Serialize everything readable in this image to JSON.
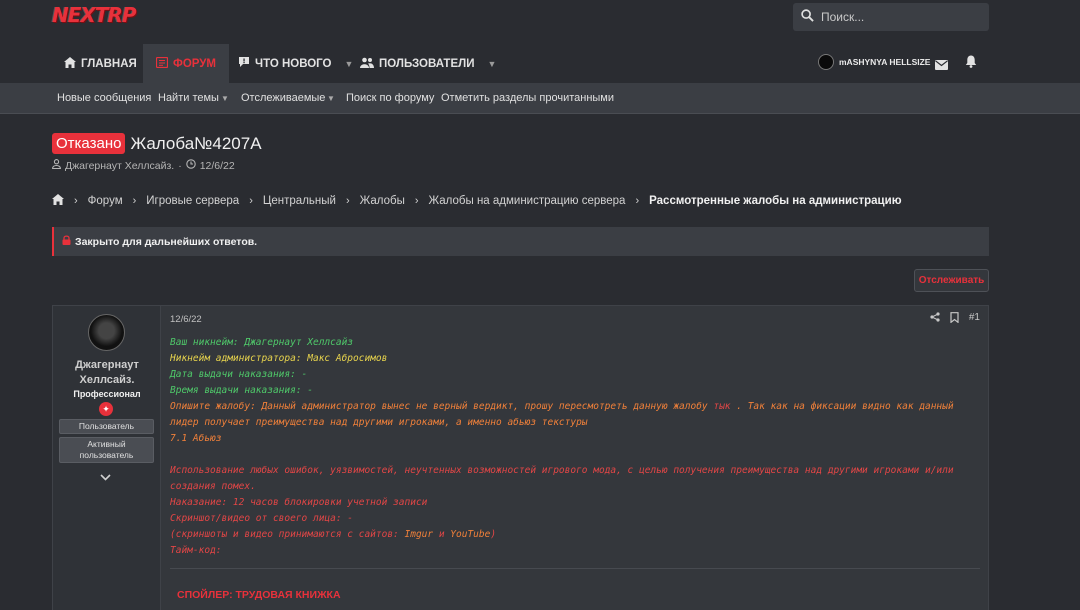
{
  "header": {
    "logo_text": "NEXTRP",
    "search_placeholder": "Поиск..."
  },
  "nav": {
    "items": [
      {
        "label": "ГЛАВНАЯ",
        "icon": "home-icon"
      },
      {
        "label": "ФОРУМ",
        "icon": "forum-icon",
        "active": true
      },
      {
        "label": "ЧТО НОВОГО",
        "icon": "whats-new-icon"
      },
      {
        "label": "ПОЛЬЗОВАТЕЛИ",
        "icon": "users-icon"
      }
    ],
    "username": "mASHYNYA HELLSIZE"
  },
  "subnav": [
    "Новые сообщения",
    "Найти темы",
    "Отслеживаемые",
    "Поиск по форуму",
    "Отметить разделы прочитанными"
  ],
  "thread": {
    "prefix": "Отказано",
    "title": "Жалоба№4207A",
    "author": "Джагернаут Хеллсайз.",
    "date": "12/6/22"
  },
  "breadcrumbs": [
    "Форум",
    "Игровые сервера",
    "Центральный",
    "Жалобы",
    "Жалобы на администрацию сервера",
    "Рассмотренные жалобы на администрацию"
  ],
  "notice": "Закрыто для дальнейших ответов.",
  "watch_button": "Отслеживать",
  "post": {
    "user_name": "Джагернаут Хеллсайз.",
    "user_role": "Профессионал",
    "banner_1": "Пользователь",
    "banner_2": "Активный пользователь",
    "date": "12/6/22",
    "number": "#1",
    "lines": {
      "l1": "Ваш никнейм: Джагернаут Хеллсайз",
      "l2": "Никнейм администратора: Макс Абросимов",
      "l3": "Дата выдачи наказания: -",
      "l4": "Время выдачи наказания: -",
      "l5a": "Опишите жалобу: Данный администратор вынес не верный вердикт, прошу пересмотреть данную жалобу ",
      "l5link": "тык",
      "l5b": " . Так как на фиксации видно как данный лидер получает преимущества над другими игроками, а именно абьюз текстуры",
      "l6": "7.1 Абьюз",
      "l7": "Использование любых ошибок, уязвимостей, неучтенных возможностей игрового мода, с целью получения преимущества над другими игроками и/или создания помех.",
      "l8": "Наказание: 12 часов блокировки учетной записи",
      "l9": "Скриншот/видео от своего лица: -",
      "l10a": "(скриншоты и видео принимаются с сайтов: ",
      "l10link1": "Imgur",
      "l10mid": " и ",
      "l10link2": "YouTube",
      "l10b": ")",
      "l11": "Тайм-код:"
    },
    "spoiler": "СПОЙЛЕР: ТРУДОВАЯ КНИЖКА"
  },
  "colors": {
    "accent": "#e8313b",
    "green": "#4fc96a",
    "yellow": "#e8d44d",
    "orange": "#f0803a",
    "red": "#e24646"
  }
}
